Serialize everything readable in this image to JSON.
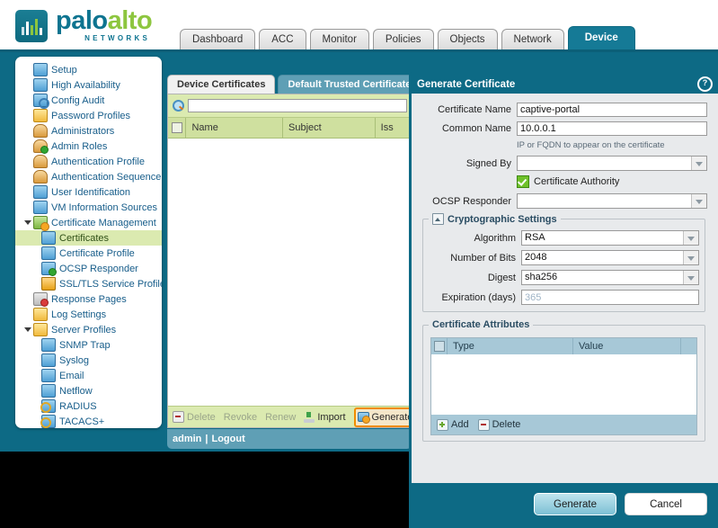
{
  "brand": {
    "name_part1": "palo",
    "name_part2": "alto",
    "subtitle": "NETWORKS",
    "logo_icon": "bar-chart-logo-icon"
  },
  "nav_tabs": [
    {
      "label": "Dashboard",
      "active": false
    },
    {
      "label": "ACC",
      "active": false
    },
    {
      "label": "Monitor",
      "active": false
    },
    {
      "label": "Policies",
      "active": false
    },
    {
      "label": "Objects",
      "active": false
    },
    {
      "label": "Network",
      "active": false
    },
    {
      "label": "Device",
      "active": true
    }
  ],
  "sidebar": {
    "items": [
      {
        "label": "Setup",
        "level": 1,
        "icon": "setup-icon",
        "selected": false,
        "expander": false
      },
      {
        "label": "High Availability",
        "level": 1,
        "icon": "high-availability-icon",
        "selected": false,
        "expander": false
      },
      {
        "label": "Config Audit",
        "level": 1,
        "icon": "config-audit-icon",
        "selected": false,
        "expander": false
      },
      {
        "label": "Password Profiles",
        "level": 1,
        "icon": "password-profiles-icon",
        "selected": false,
        "expander": false
      },
      {
        "label": "Administrators",
        "level": 1,
        "icon": "administrators-icon",
        "selected": false,
        "expander": false
      },
      {
        "label": "Admin Roles",
        "level": 1,
        "icon": "admin-roles-icon",
        "selected": false,
        "expander": false
      },
      {
        "label": "Authentication Profile",
        "level": 1,
        "icon": "authentication-profile-icon",
        "selected": false,
        "expander": false
      },
      {
        "label": "Authentication Sequence",
        "level": 1,
        "icon": "authentication-sequence-icon",
        "selected": false,
        "expander": false
      },
      {
        "label": "User Identification",
        "level": 1,
        "icon": "user-identification-icon",
        "selected": false,
        "expander": false
      },
      {
        "label": "VM Information Sources",
        "level": 1,
        "icon": "vm-information-sources-icon",
        "selected": false,
        "expander": false
      },
      {
        "label": "Certificate Management",
        "level": 1,
        "icon": "certificate-management-icon",
        "selected": false,
        "expander": true
      },
      {
        "label": "Certificates",
        "level": 2,
        "icon": "certificates-icon",
        "selected": true,
        "expander": false
      },
      {
        "label": "Certificate Profile",
        "level": 2,
        "icon": "certificate-profile-icon",
        "selected": false,
        "expander": false
      },
      {
        "label": "OCSP Responder",
        "level": 2,
        "icon": "ocsp-responder-icon",
        "selected": false,
        "expander": false
      },
      {
        "label": "SSL/TLS Service Profile",
        "level": 2,
        "icon": "ssl-tls-service-profile-icon",
        "selected": false,
        "expander": false
      },
      {
        "label": "Response Pages",
        "level": 1,
        "icon": "response-pages-icon",
        "selected": false,
        "expander": false
      },
      {
        "label": "Log Settings",
        "level": 1,
        "icon": "log-settings-icon",
        "selected": false,
        "expander": false
      },
      {
        "label": "Server Profiles",
        "level": 1,
        "icon": "server-profiles-icon",
        "selected": false,
        "expander": true
      },
      {
        "label": "SNMP Trap",
        "level": 2,
        "icon": "snmp-trap-icon",
        "selected": false,
        "expander": false
      },
      {
        "label": "Syslog",
        "level": 2,
        "icon": "syslog-icon",
        "selected": false,
        "expander": false
      },
      {
        "label": "Email",
        "level": 2,
        "icon": "email-icon",
        "selected": false,
        "expander": false
      },
      {
        "label": "Netflow",
        "level": 2,
        "icon": "netflow-icon",
        "selected": false,
        "expander": false
      },
      {
        "label": "RADIUS",
        "level": 2,
        "icon": "radius-icon",
        "selected": false,
        "expander": false
      },
      {
        "label": "TACACS+",
        "level": 2,
        "icon": "tacacs-icon",
        "selected": false,
        "expander": false
      }
    ]
  },
  "panel": {
    "tabs": [
      {
        "label": "Device Certificates",
        "active": true
      },
      {
        "label": "Default Trusted Certificate Au",
        "active": false
      }
    ],
    "search": {
      "value": "",
      "placeholder": "",
      "icon": "search-icon"
    },
    "columns": [
      "Name",
      "Subject",
      "Iss"
    ],
    "rows": [],
    "footer_buttons": [
      {
        "label": "Delete",
        "icon": "minus-icon",
        "disabled": true,
        "highlighted": false
      },
      {
        "label": "Revoke",
        "icon": "",
        "disabled": true,
        "highlighted": false
      },
      {
        "label": "Renew",
        "icon": "",
        "disabled": true,
        "highlighted": false
      },
      {
        "label": "Import",
        "icon": "import-icon",
        "disabled": false,
        "highlighted": false
      },
      {
        "label": "Generate",
        "icon": "generate-icon",
        "disabled": false,
        "highlighted": true
      }
    ],
    "status_user": "admin",
    "status_separator": "|",
    "status_logout": "Logout"
  },
  "dialog": {
    "title": "Generate Certificate",
    "help_icon": "help-icon",
    "fields": [
      {
        "label": "Certificate Name",
        "value": "captive-portal",
        "type": "text",
        "placeholder": ""
      },
      {
        "label": "Common Name",
        "value": "10.0.0.1",
        "type": "text",
        "placeholder": ""
      }
    ],
    "common_name_hint": "IP or FQDN to appear on the certificate",
    "signed_by": {
      "label": "Signed By",
      "value": "",
      "type": "select"
    },
    "certificate_authority": {
      "label": "Certificate Authority",
      "checked": true
    },
    "ocsp_responder": {
      "label": "OCSP Responder",
      "value": "",
      "type": "select"
    },
    "crypto_group": {
      "legend": "Cryptographic Settings",
      "collapse_icon": "collapse-icon",
      "fields": [
        {
          "label": "Algorithm",
          "value": "RSA",
          "type": "select"
        },
        {
          "label": "Number of Bits",
          "value": "2048",
          "type": "select"
        },
        {
          "label": "Digest",
          "value": "sha256",
          "type": "select"
        },
        {
          "label": "Expiration (days)",
          "value": "",
          "type": "text",
          "placeholder": "365"
        }
      ]
    },
    "attributes_group": {
      "legend": "Certificate Attributes",
      "columns": [
        "Type",
        "Value"
      ],
      "rows": [],
      "footer_buttons": [
        {
          "label": "Add",
          "icon": "plus-icon"
        },
        {
          "label": "Delete",
          "icon": "minus-icon"
        }
      ]
    },
    "footer_buttons": [
      {
        "label": "Generate",
        "style": "primary"
      },
      {
        "label": "Cancel",
        "style": "secondary"
      }
    ]
  },
  "colors": {
    "brand_teal": "#0d6a85",
    "brand_green": "#8dc63f",
    "table_green": "#dbeab0",
    "highlight_orange": "#f08c00",
    "dialog_bg": "#e8eaec"
  }
}
